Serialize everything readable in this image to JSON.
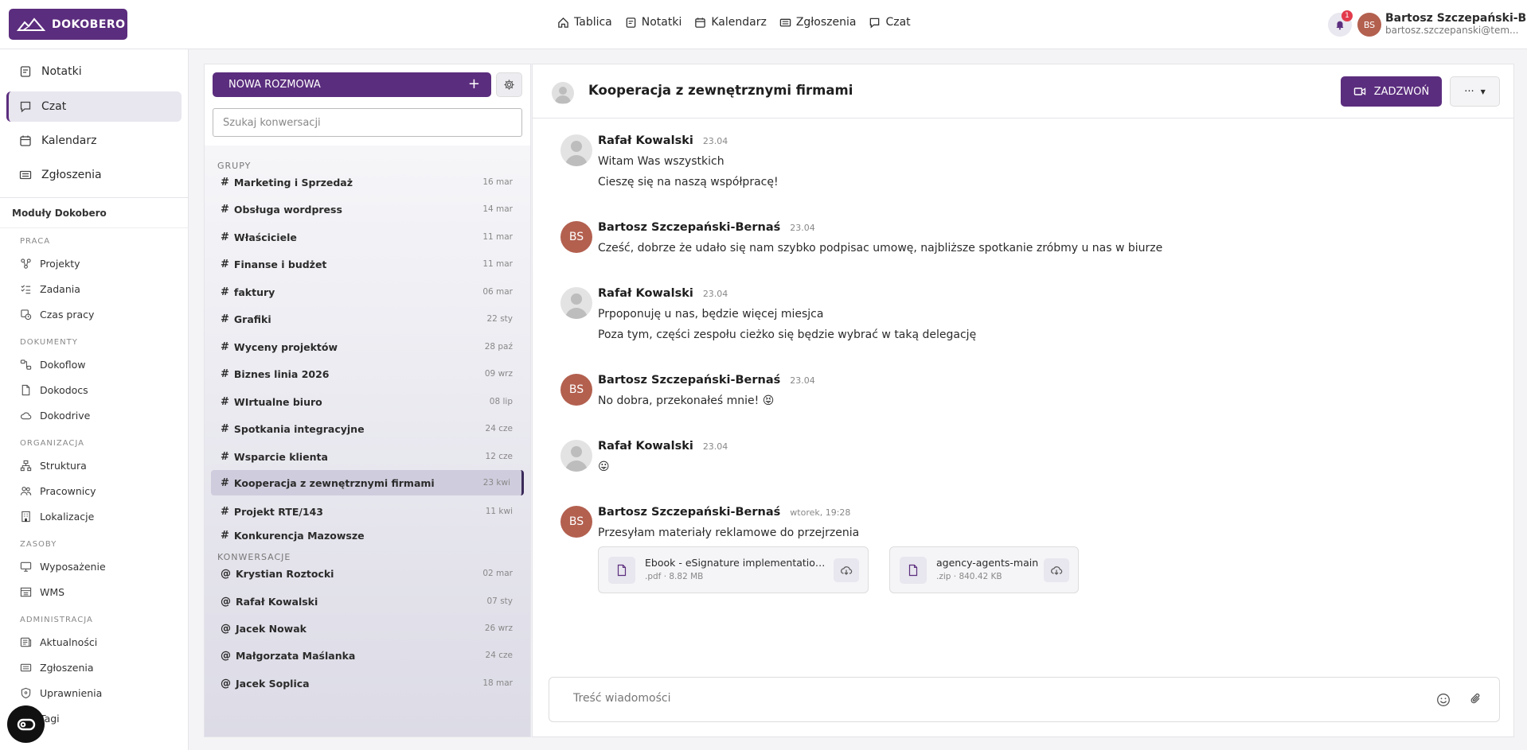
{
  "app": {
    "logo_text": "DOKOBERO"
  },
  "topnav": [
    {
      "label": "Tablica",
      "icon": "home-icon"
    },
    {
      "label": "Notatki",
      "icon": "note-icon"
    },
    {
      "label": "Kalendarz",
      "icon": "calendar-icon"
    },
    {
      "label": "Zgłoszenia",
      "icon": "ticket-icon"
    },
    {
      "label": "Czat",
      "icon": "chat-icon"
    }
  ],
  "notifications": {
    "count": "1"
  },
  "user": {
    "initials": "BS",
    "name": "Bartosz Szczepański-B...",
    "email": "bartosz.szczepanski@tem..."
  },
  "sidebar": {
    "main": [
      {
        "label": "Notatki",
        "icon": "note-icon"
      },
      {
        "label": "Czat",
        "icon": "chat-icon",
        "active": true
      },
      {
        "label": "Kalendarz",
        "icon": "calendar-icon"
      },
      {
        "label": "Zgłoszenia",
        "icon": "ticket-icon"
      }
    ],
    "modules_title": "Moduły Dokobero",
    "sections": [
      {
        "title": "PRACA",
        "items": [
          "Projekty",
          "Zadania",
          "Czas pracy"
        ]
      },
      {
        "title": "DOKUMENTY",
        "items": [
          "Dokoflow",
          "Dokodocs",
          "Dokodrive"
        ]
      },
      {
        "title": "ORGANIZACJA",
        "items": [
          "Struktura",
          "Pracownicy",
          "Lokalizacje"
        ]
      },
      {
        "title": "ZASOBY",
        "items": [
          "Wyposażenie",
          "WMS"
        ]
      },
      {
        "title": "ADMINISTRACJA",
        "items": [
          "Aktualności",
          "Zgłoszenia",
          "Uprawnienia",
          "Tagi"
        ]
      }
    ]
  },
  "conversations": {
    "new_button": "NOWA ROZMOWA",
    "search_placeholder": "Szukaj konwersacji",
    "groups_title": "GRUPY",
    "groups": [
      {
        "name": "Marketing i Sprzedaż",
        "date": "16 mar"
      },
      {
        "name": "Obsługa wordpress",
        "date": "14 mar"
      },
      {
        "name": "Właściciele",
        "date": "11 mar"
      },
      {
        "name": "Finanse i budżet",
        "date": "11 mar"
      },
      {
        "name": "faktury",
        "date": "06 mar"
      },
      {
        "name": "Grafiki",
        "date": "22 sty"
      },
      {
        "name": "Wyceny projektów",
        "date": "28 paź"
      },
      {
        "name": "Biznes linia 2026",
        "date": "09 wrz"
      },
      {
        "name": "WIrtualne biuro",
        "date": "08 lip"
      },
      {
        "name": "Spotkania integracyjne",
        "date": "24 cze"
      },
      {
        "name": "Wsparcie klienta",
        "date": "12 cze"
      },
      {
        "name": "Kooperacja z zewnętrznymi firmami",
        "date": "23 kwi",
        "active": true
      },
      {
        "name": "Projekt RTE/143",
        "date": "11 kwi"
      },
      {
        "name": "Konkurencja Mazowsze",
        "date": ""
      }
    ],
    "direct_title": "KONWERSACJE",
    "direct": [
      {
        "name": "Krystian Roztocki",
        "date": "02 mar"
      },
      {
        "name": "Rafał Kowalski",
        "date": "07 sty"
      },
      {
        "name": "Jacek Nowak",
        "date": "26 wrz"
      },
      {
        "name": "Małgorzata Maślanka",
        "date": "24 cze"
      },
      {
        "name": "Jacek Soplica",
        "date": "18 mar"
      }
    ]
  },
  "chat": {
    "title": "Kooperacja z zewnętrznymi firmami",
    "call_label": "ZADZWOŃ",
    "more_label": "···",
    "composer_placeholder": "Treść wiadomości",
    "messages": [
      {
        "author": "Rafał Kowalski",
        "avatar": "photo",
        "time": "23.04",
        "lines": [
          "Witam Was wszystkich",
          "Cieszę się na naszą współpracę!"
        ]
      },
      {
        "author": "Bartosz Szczepański-Bernaś",
        "avatar": "BS",
        "time": "23.04",
        "lines": [
          "Cześć, dobrze że udało się nam szybko podpisac umowę, najbliższe spotkanie zróbmy u nas w biurze"
        ]
      },
      {
        "author": "Rafał Kowalski",
        "avatar": "photo",
        "time": "23.04",
        "lines": [
          "Prpoponuję u nas, będzie więcej miesjca",
          "Poza tym, części zespołu cieżko się będzie wybrać w taką delegację"
        ]
      },
      {
        "author": "Bartosz Szczepański-Bernaś",
        "avatar": "BS",
        "time": "23.04",
        "lines": [
          "No dobra, przekonałeś mnie! 😝"
        ]
      },
      {
        "author": "Rafał Kowalski",
        "avatar": "photo",
        "time": "23.04",
        "lines": [
          "😛"
        ]
      },
      {
        "author": "Bartosz Szczepański-Bernaś",
        "avatar": "BS",
        "time": "wtorek, 19:28",
        "lines": [
          "Przesyłam materiały reklamowe do przejrzenia"
        ]
      }
    ],
    "attachments": [
      {
        "name": "Ebook - eSignature implementation guide",
        "meta": ".pdf · 8.82 MB"
      },
      {
        "name": "agency-agents-main",
        "meta": ".zip · 840.42 KB"
      }
    ]
  },
  "colors": {
    "brand": "#5b2d7e",
    "avatar_bs": "#b3604f",
    "badge": "#e23b4c"
  }
}
